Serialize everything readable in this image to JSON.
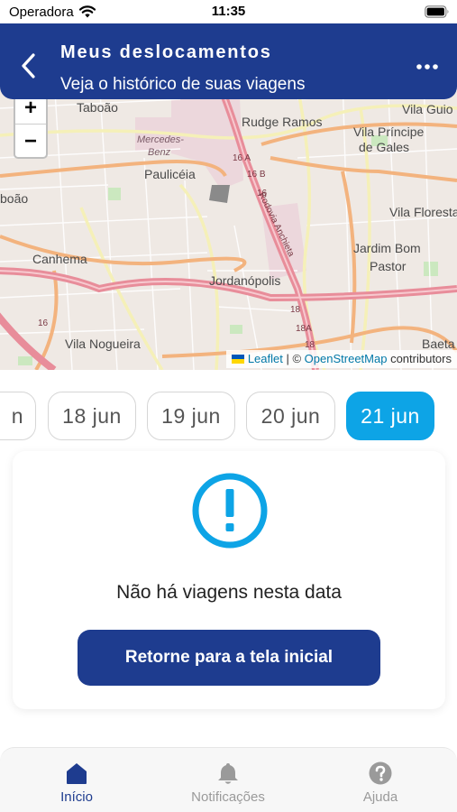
{
  "status_bar": {
    "carrier": "Operadora",
    "time": "11:35",
    "wifi_icon": "wifi-icon",
    "battery_icon": "battery-icon"
  },
  "header": {
    "title": "Meus deslocamentos",
    "subtitle": "Veja o histórico de suas viagens",
    "back_icon": "chevron-left-icon",
    "more_icon": "more-horizontal-icon",
    "color": "#1e3c8f"
  },
  "map": {
    "zoom_in": "+",
    "zoom_out": "−",
    "places": {
      "taboao": "Taboão",
      "mercedes_1": "Mercedes-",
      "mercedes_2": "Benz",
      "pauliceia": "Paulicéia",
      "rudge": "Rudge Ramos",
      "vila_guio": "Vila Guio",
      "vila_principe_1": "Vila Príncipe",
      "vila_principe_2": "de Gales",
      "boao": "boão",
      "vila_floresta": "Vila Floresta",
      "canhema": "Canhema",
      "jardim_1": "Jardim Bom",
      "jardim_2": "Pastor",
      "jordanopolis": "Jordanópolis",
      "vila_nogueira": "Vila Nogueira",
      "baeta": "Baeta",
      "rodovia": "Rodovia Anchieta",
      "r16a": "16 A",
      "r16b": "16 B",
      "r16": "16",
      "r18": "18",
      "r18a": "18A"
    },
    "attribution": {
      "leaflet": "Leaflet",
      "sep": " | © ",
      "osm": "OpenStreetMap",
      "contrib": " contributors"
    }
  },
  "dates": {
    "partial": "n",
    "items": [
      "18 jun",
      "19 jun",
      "20 jun",
      "21 jun"
    ],
    "selected": "21 jun",
    "accent": "#0da4e6"
  },
  "empty_state": {
    "icon": "alert-circle-icon",
    "message": "Não há viagens nesta data",
    "button": "Retorne para a tela inicial"
  },
  "bottom_nav": {
    "items": [
      {
        "label": "Início",
        "icon": "home-icon",
        "active": true
      },
      {
        "label": "Notificações",
        "icon": "bell-icon",
        "active": false
      },
      {
        "label": "Ajuda",
        "icon": "help-icon",
        "active": false
      }
    ]
  }
}
